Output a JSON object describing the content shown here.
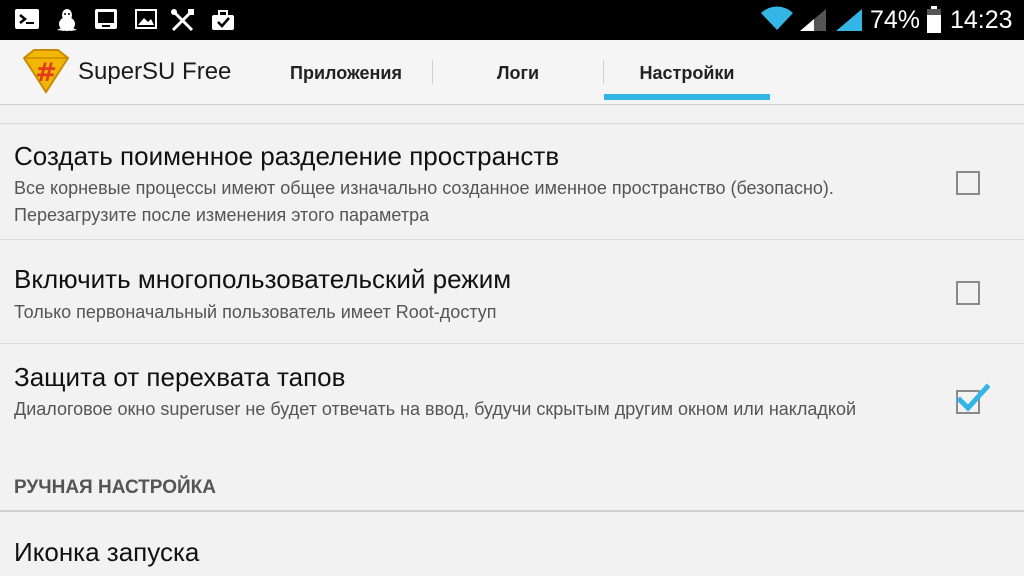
{
  "status_bar": {
    "battery_percent": "74%",
    "time": "14:23",
    "left_icons": [
      "terminal-icon",
      "linux-tux-icon",
      "screen-icon",
      "image-icon",
      "tools-icon",
      "briefcase-icon"
    ],
    "right_icons": [
      "wifi-icon",
      "signal-icon",
      "signal-icon",
      "battery-icon"
    ]
  },
  "action_bar": {
    "app_name": "SuperSU Free",
    "tabs": [
      {
        "label": "Приложения",
        "selected": false
      },
      {
        "label": "Логи",
        "selected": false
      },
      {
        "label": "Настройки",
        "selected": true
      }
    ],
    "accent_color": "#33b5e5"
  },
  "settings": {
    "items": [
      {
        "title": "Создать поименное разделение пространств",
        "summary": "Все корневые процессы имеют общее изначально созданное именное пространство (безопасно). Перезагрузите после изменения этого параметра",
        "checked": false
      },
      {
        "title": "Включить многопользовательский режим",
        "summary": "Только первоначальный пользователь имеет Root-доступ",
        "checked": false
      },
      {
        "title": "Защита от перехвата тапов",
        "summary": "Диалоговое окно superuser не будет отвечать на ввод, будучи скрытым другим окном или накладкой",
        "checked": true
      }
    ],
    "section_header": "РУЧНАЯ НАСТРОЙКА",
    "launcher_item": {
      "title": "Иконка запуска"
    }
  }
}
